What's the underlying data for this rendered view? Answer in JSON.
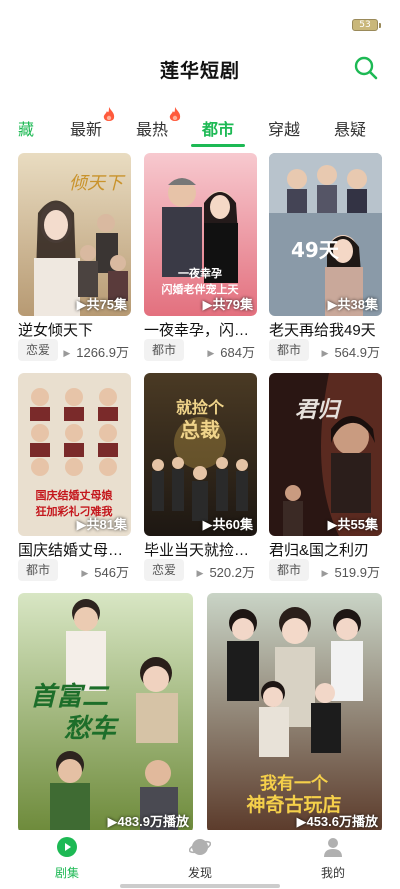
{
  "status_bar": {
    "battery": "53"
  },
  "header": {
    "title": "莲华短剧",
    "search_icon": "search-icon"
  },
  "tabs": [
    {
      "label": "藏"
    },
    {
      "label": "最新"
    },
    {
      "label": "最热"
    },
    {
      "label": "都市"
    },
    {
      "label": "穿越"
    },
    {
      "label": "悬疑"
    }
  ],
  "colors": {
    "accent": "#1db954"
  },
  "cards": [
    {
      "title": "逆女倾天下",
      "tag": "恋爱",
      "plays": "1266.9万",
      "episodes": "▶共75集",
      "poster_text": "倾天下"
    },
    {
      "title": "一夜幸孕，闪…",
      "tag": "都市",
      "plays": "684万",
      "episodes": "▶共79集",
      "poster_text": "一夜幸孕 闪婚老伴宠上天"
    },
    {
      "title": "老天再给我49天",
      "tag": "都市",
      "plays": "564.9万",
      "episodes": "▶共38集",
      "poster_text": "老天再给我49天"
    },
    {
      "title": "国庆结婚丈母…",
      "tag": "都市",
      "plays": "546万",
      "episodes": "▶共81集",
      "poster_text": "国庆结婚丈母娘 狂加彩礼刁难我"
    },
    {
      "title": "毕业当天就捡…",
      "tag": "恋爱",
      "plays": "520.2万",
      "episodes": "▶共60集",
      "poster_text": "就捡个总裁"
    },
    {
      "title": "君归&国之利刃",
      "tag": "都市",
      "plays": "519.9万",
      "episodes": "▶共55集",
      "poster_text": "君归"
    },
    {
      "plays_badge": "▶483.9万播放",
      "poster_text": "首富二愁车"
    },
    {
      "plays_badge": "▶453.6万播放",
      "poster_text": "我有一个 神奇古玩店"
    }
  ],
  "bottom_nav": [
    {
      "label": "剧集",
      "icon": "play-circle-icon"
    },
    {
      "label": "发现",
      "icon": "planet-icon"
    },
    {
      "label": "我的",
      "icon": "user-icon"
    }
  ]
}
